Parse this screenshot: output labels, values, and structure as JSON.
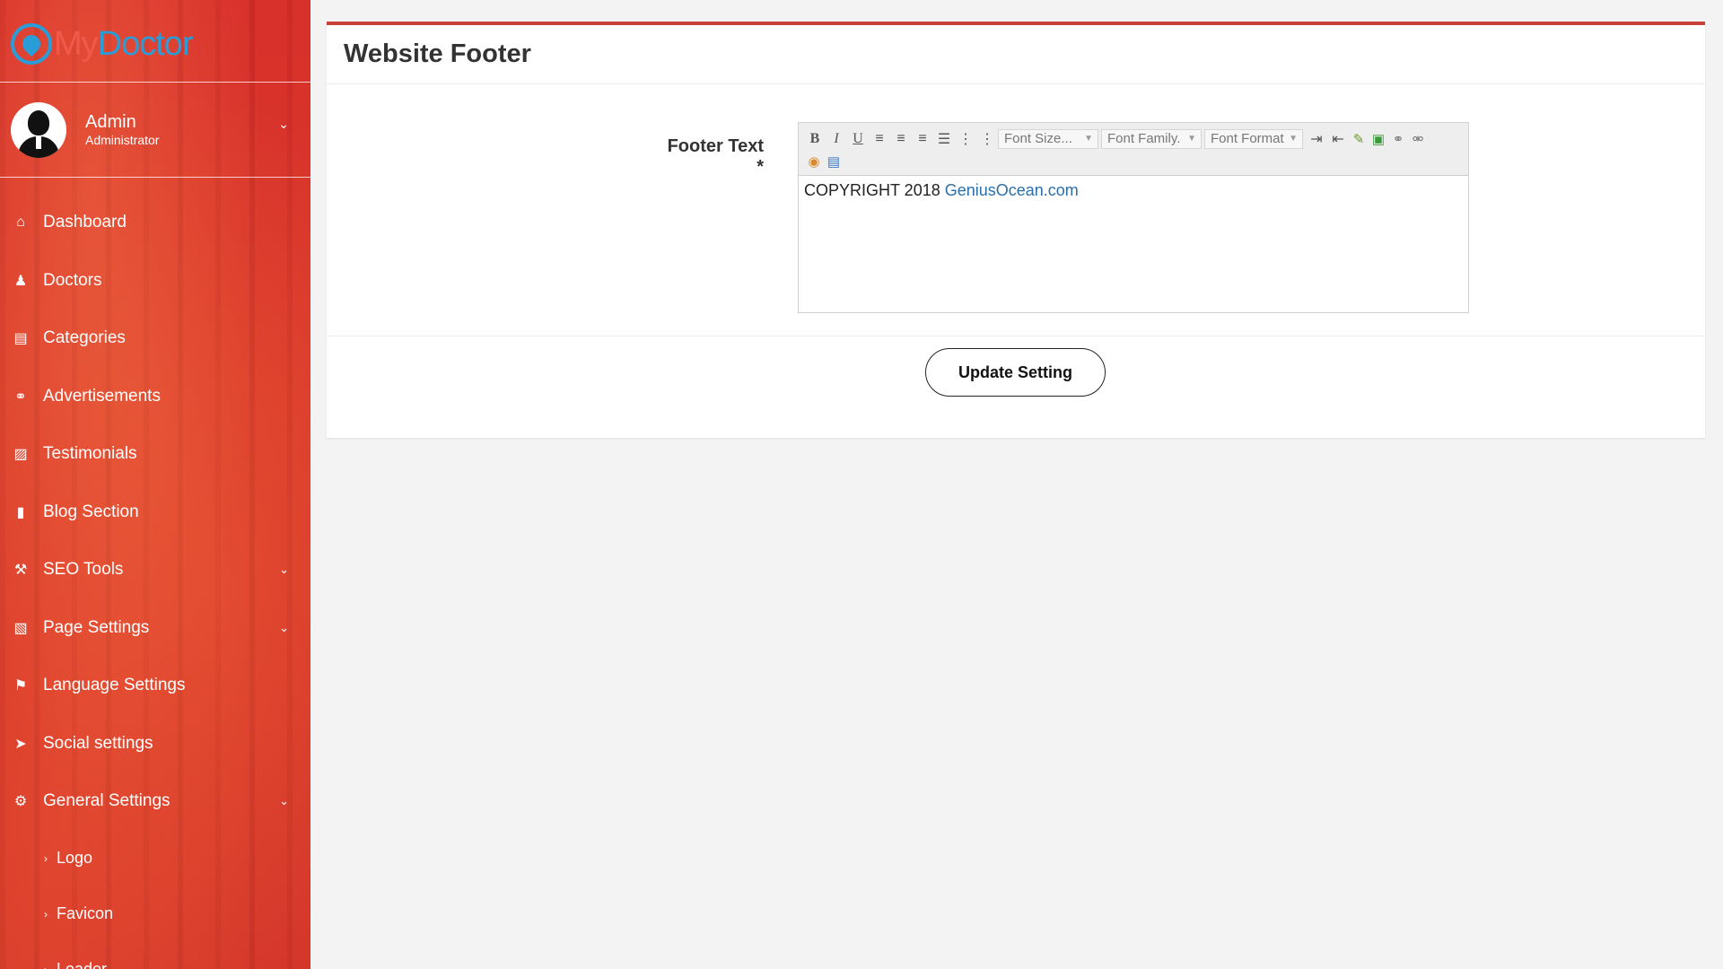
{
  "sidebar": {
    "logo": {
      "part1": "My",
      "part2": "Doctor"
    },
    "user": {
      "name": "Admin",
      "role": "Administrator"
    },
    "items": [
      {
        "label": "Dashboard",
        "icon": "home-icon",
        "glyph": "⌂"
      },
      {
        "label": "Doctors",
        "icon": "user-md-icon",
        "glyph": "♟"
      },
      {
        "label": "Categories",
        "icon": "clipboard-icon",
        "glyph": "▤"
      },
      {
        "label": "Advertisements",
        "icon": "link-icon",
        "glyph": "⚭"
      },
      {
        "label": "Testimonials",
        "icon": "image-icon",
        "glyph": "▨"
      },
      {
        "label": "Blog Section",
        "icon": "file-icon",
        "glyph": "▮"
      },
      {
        "label": "SEO Tools",
        "icon": "wrench-icon",
        "glyph": "⚒"
      },
      {
        "label": "Page Settings",
        "icon": "file-code-icon",
        "glyph": "▧"
      },
      {
        "label": "Language Settings",
        "icon": "language-icon",
        "glyph": "⚑"
      },
      {
        "label": "Social settings",
        "icon": "paper-plane-icon",
        "glyph": "➤"
      },
      {
        "label": "General Settings",
        "icon": "cogs-icon",
        "glyph": "⚙"
      }
    ],
    "sub_items": [
      {
        "label": "Logo"
      },
      {
        "label": "Favicon"
      },
      {
        "label": "Loader"
      }
    ]
  },
  "main": {
    "title": "Website Footer",
    "field_label": "Footer Text *",
    "editor": {
      "font_size_placeholder": "Font Size...",
      "font_family_placeholder": "Font Family.",
      "font_format_placeholder": "Font Format",
      "content_text": "COPYRIGHT 2018 ",
      "content_link": "GeniusOcean.com"
    },
    "submit_label": "Update Setting"
  },
  "colors": {
    "sidebar_bg": "#d8302b",
    "panel_accent": "#c9403b",
    "logo_blue": "#2a9cd8",
    "link": "#2a6fa8"
  }
}
